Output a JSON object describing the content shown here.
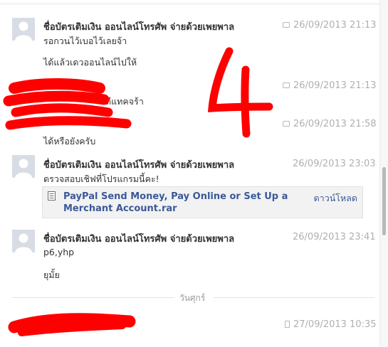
{
  "thread": {
    "sender_name": "ชื่อบัตรเติมเงิน ออนไลน์โทรศัพ จ่ายด้วยเพยพาล",
    "day_divider": "วันศุกร์"
  },
  "messages": {
    "m1": {
      "time": "26/09/2013 21:13",
      "lines": [
        "รอกวนไว้เบอไว้เลยจ้า",
        "ได้แล้วเดวออนไลน์ไปให้"
      ]
    },
    "m2": {
      "time": "26/09/2013 21:13",
      "line": "ดีแทคจร้า"
    },
    "m3": {
      "time": "26/09/2013 21:58",
      "line": "ได้หรือยังครับ"
    },
    "m4": {
      "time": "26/09/2013 23:03",
      "line": "ตรวจสอบเชิฟที่โปรแกรมนี้คะ!",
      "attachment": {
        "file_name": "PayPal Send Money, Pay Online or Set Up a Merchant Account.rar",
        "download_label": "ดาวน์โหลด"
      }
    },
    "m5": {
      "time": "26/09/2013 23:41",
      "lines": [
        "p6,yhp",
        "ยุมั้ย"
      ]
    },
    "m6": {
      "time": "27/09/2013 10:35"
    }
  },
  "annotation": {
    "text": "4",
    "color": "#ff0000"
  },
  "colors": {
    "link": "#3b5998",
    "timestamp": "#b0b0b0",
    "redaction": "#ff0000"
  },
  "icons": [
    "avatar-placeholder-icon",
    "message-icon",
    "file-icon",
    "mobile-icon"
  ]
}
